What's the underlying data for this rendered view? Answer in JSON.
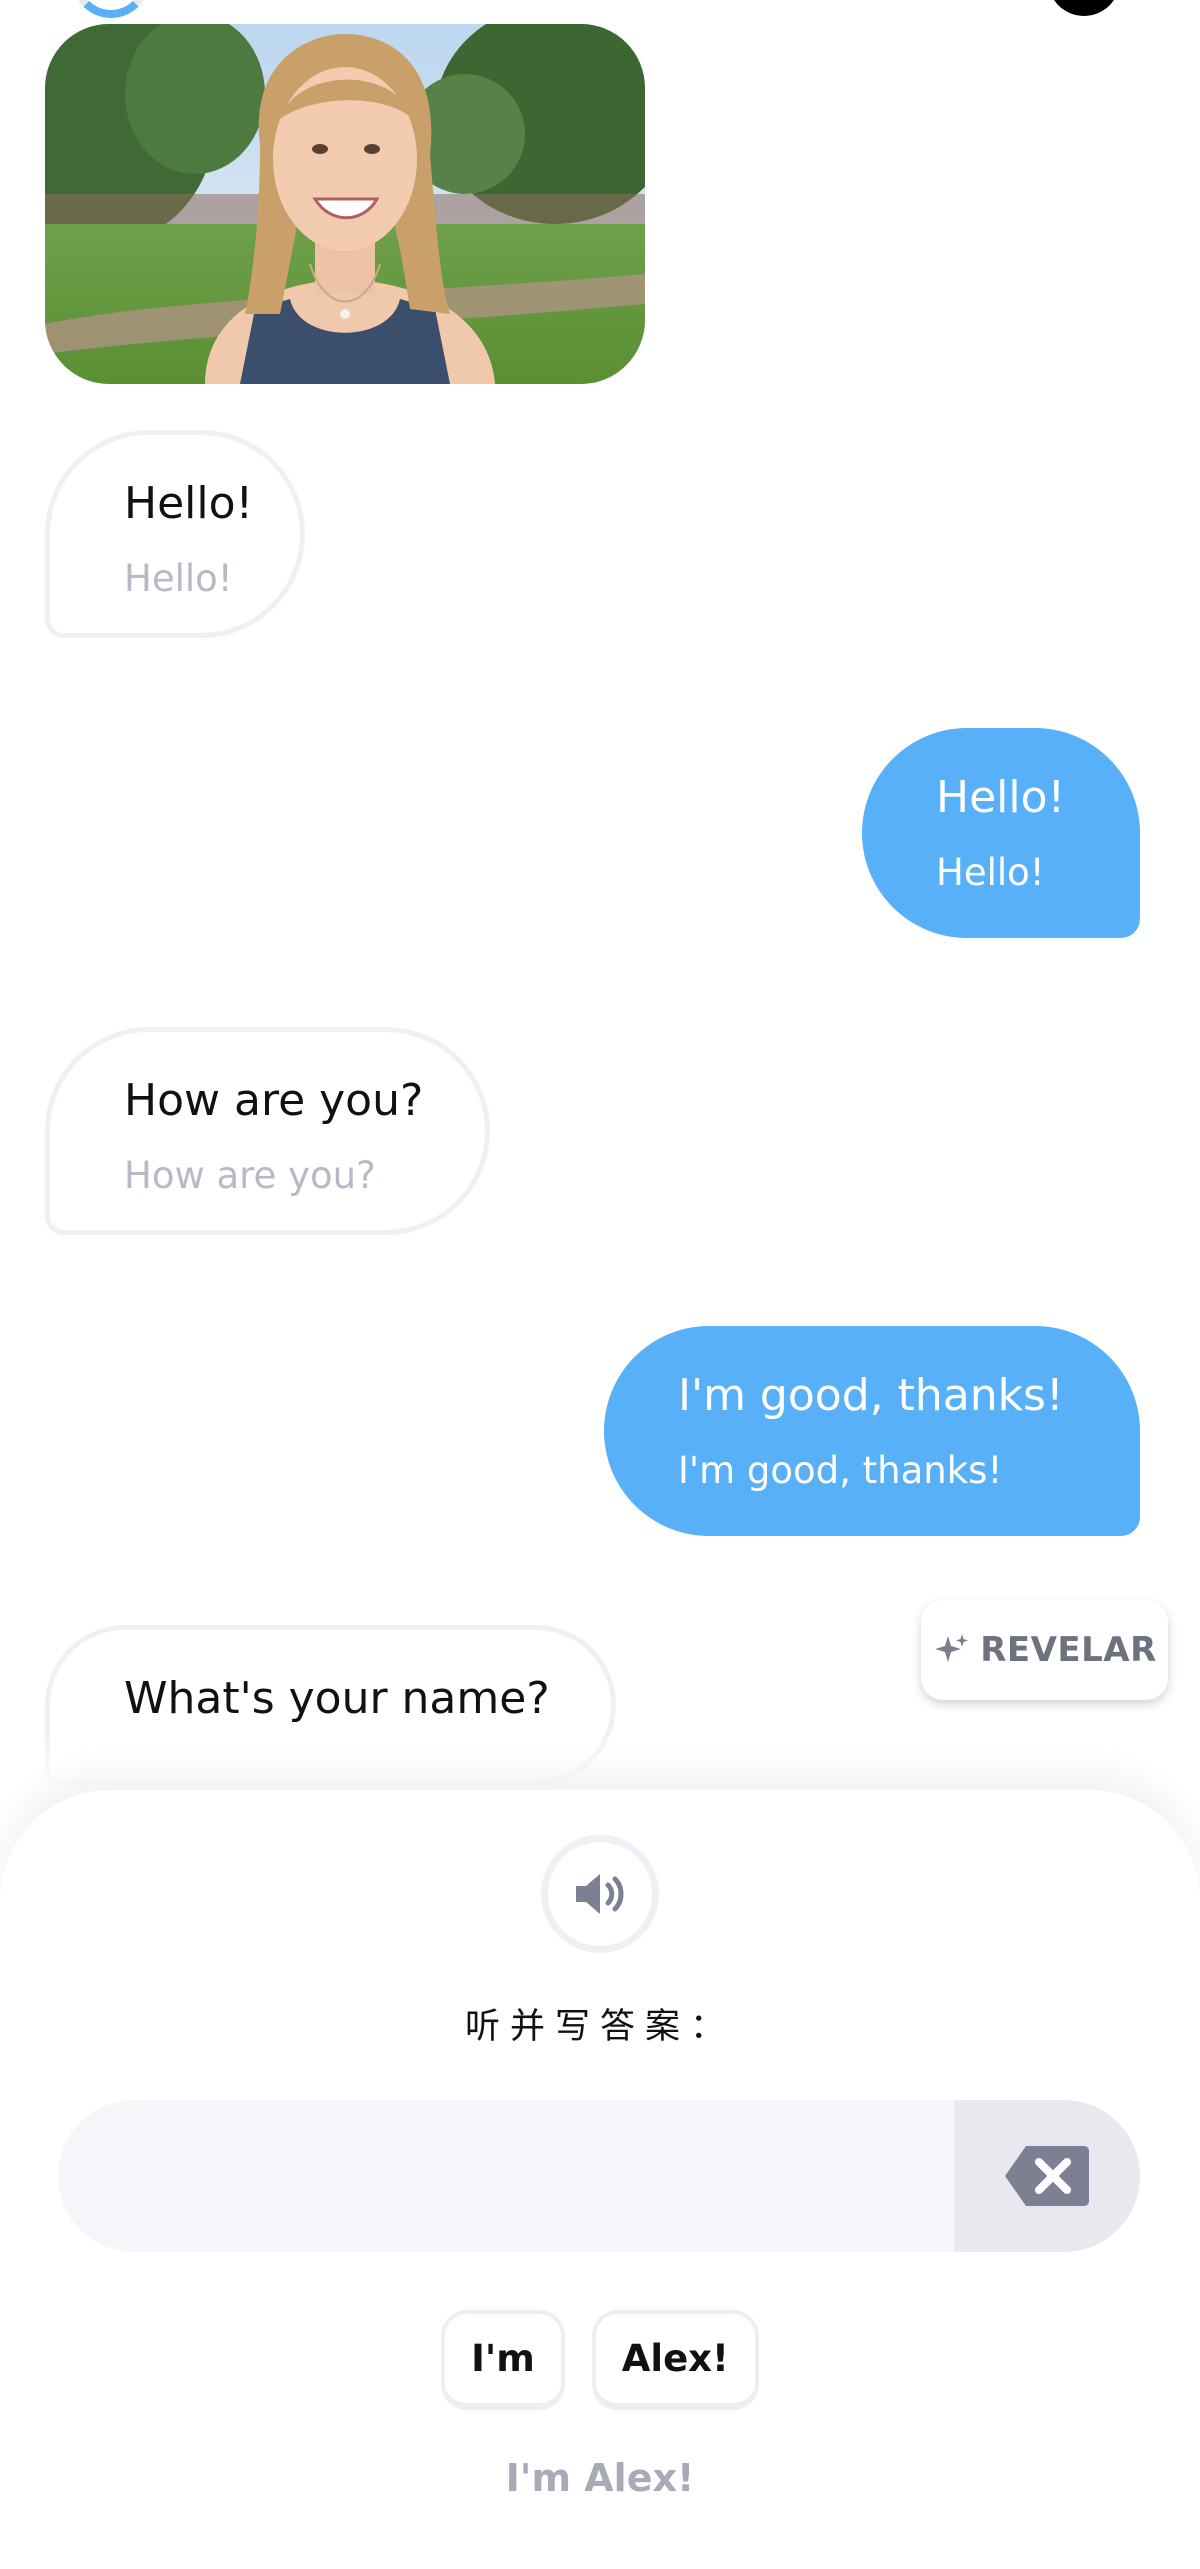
{
  "conversation": {
    "messages": [
      {
        "side": "incoming",
        "text": "Hello!",
        "translation": "Hello!"
      },
      {
        "side": "outgoing",
        "text": "Hello!",
        "translation": "Hello!"
      },
      {
        "side": "incoming",
        "text": "How are you?",
        "translation": "How are you?"
      },
      {
        "side": "outgoing",
        "text": "I'm good, thanks!",
        "translation": "I'm good, thanks!"
      },
      {
        "side": "incoming",
        "text": "What's your name?"
      }
    ]
  },
  "reveal_button": {
    "label": "REVELAR",
    "icon": "sparkle-icon"
  },
  "exercise": {
    "speaker_icon": "speaker-icon",
    "instruction": "听并写答案：",
    "answer_value": "",
    "clear_icon": "backspace-icon",
    "word_bank": [
      "I'm",
      "Alex!"
    ],
    "preview": "I'm Alex!"
  },
  "colors": {
    "accent_blue": "#58b0f8",
    "bubble_border": "#eef0f5",
    "muted_text": "#a7abb5"
  }
}
